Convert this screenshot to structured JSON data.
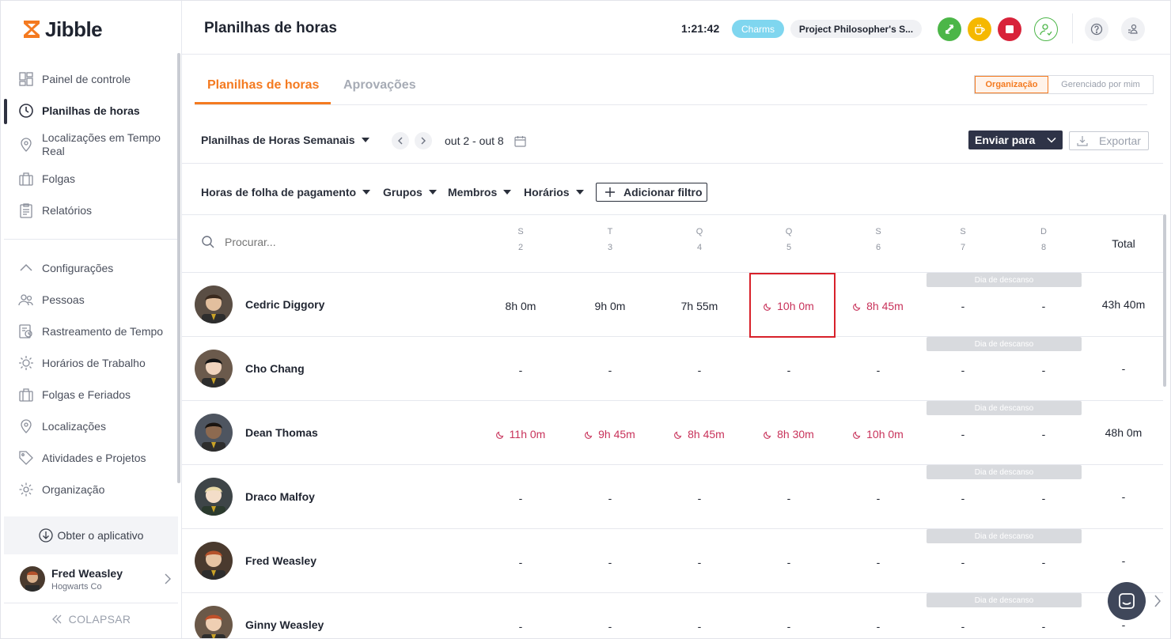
{
  "sidebar": {
    "logo": "Jibble",
    "nav": [
      {
        "label": "Painel de controle",
        "icon": "dashboard-icon"
      },
      {
        "label": "Planilhas de horas",
        "icon": "clock-icon",
        "active": true
      },
      {
        "label": "Localizações em Tempo Real",
        "icon": "location-pin-icon"
      },
      {
        "label": "Folgas",
        "icon": "suitcase-icon"
      },
      {
        "label": "Relatórios",
        "icon": "clipboard-icon"
      }
    ],
    "settings_label": "Configurações",
    "settings": [
      {
        "label": "Pessoas",
        "icon": "people-icon"
      },
      {
        "label": "Rastreamento de Tempo",
        "icon": "time-tracking-icon"
      },
      {
        "label": "Horários de Trabalho",
        "icon": "sun-schedule-icon"
      },
      {
        "label": "Folgas e Feriados",
        "icon": "suitcase-icon"
      },
      {
        "label": "Localizações",
        "icon": "location-pin-icon"
      },
      {
        "label": "Atividades e Projetos",
        "icon": "tag-icon"
      },
      {
        "label": "Organização",
        "icon": "gear-icon"
      }
    ],
    "get_app": "Obter o aplicativo",
    "user": {
      "name": "Fred Weasley",
      "org": "Hogwarts Co"
    },
    "collapse": "COLAPSAR"
  },
  "header": {
    "title": "Planilhas de horas",
    "timer": "1:21:42",
    "activity": "Charms",
    "project": "Project Philosopher's S...",
    "colors": {
      "green": "#4cb648",
      "yellow": "#f5b800",
      "red": "#d8233a",
      "activity": "#7fd6ef"
    }
  },
  "tabs": [
    {
      "label": "Planilhas de horas",
      "active": true
    },
    {
      "label": "Aprovações"
    }
  ],
  "scope_toggle": {
    "options": [
      "Organização",
      "Gerenciado por mim"
    ],
    "selected": "Organização"
  },
  "toolbar": {
    "view": "Planilhas de Horas Semanais",
    "range": "out 2 - out 8",
    "send": "Enviar para",
    "export": "Exportar"
  },
  "filters": {
    "items": [
      "Horas de folha de pagamento",
      "Grupos",
      "Membros",
      "Horários"
    ],
    "add": "Adicionar filtro"
  },
  "table": {
    "search_placeholder": "Procurar...",
    "days": [
      {
        "letter": "S",
        "num": "2"
      },
      {
        "letter": "T",
        "num": "3"
      },
      {
        "letter": "Q",
        "num": "4"
      },
      {
        "letter": "Q",
        "num": "5"
      },
      {
        "letter": "S",
        "num": "6"
      },
      {
        "letter": "S",
        "num": "7"
      },
      {
        "letter": "D",
        "num": "8"
      }
    ],
    "total_label": "Total",
    "rest_label": "Dia de descanso",
    "rows": [
      {
        "name": "Cedric Diggory",
        "cells": [
          "8h 0m",
          "9h 0m",
          "7h 55m",
          "10h 0m",
          "8h 45m",
          "-",
          "-"
        ],
        "overtime": [
          false,
          false,
          false,
          true,
          true,
          false,
          false
        ],
        "total": "43h 40m"
      },
      {
        "name": "Cho Chang",
        "cells": [
          "-",
          "-",
          "-",
          "-",
          "-",
          "-",
          "-"
        ],
        "overtime": [
          false,
          false,
          false,
          false,
          false,
          false,
          false
        ],
        "total": "-"
      },
      {
        "name": "Dean Thomas",
        "cells": [
          "11h 0m",
          "9h 45m",
          "8h 45m",
          "8h 30m",
          "10h 0m",
          "-",
          "-"
        ],
        "overtime": [
          true,
          true,
          true,
          true,
          true,
          false,
          false
        ],
        "total": "48h 0m"
      },
      {
        "name": "Draco Malfoy",
        "cells": [
          "-",
          "-",
          "-",
          "-",
          "-",
          "-",
          "-"
        ],
        "overtime": [
          false,
          false,
          false,
          false,
          false,
          false,
          false
        ],
        "total": "-"
      },
      {
        "name": "Fred Weasley",
        "cells": [
          "-",
          "-",
          "-",
          "-",
          "-",
          "-",
          "-"
        ],
        "overtime": [
          false,
          false,
          false,
          false,
          false,
          false,
          false
        ],
        "total": "-"
      },
      {
        "name": "Ginny Weasley",
        "cells": [
          "-",
          "-",
          "-",
          "-",
          "-",
          "-",
          "-"
        ],
        "overtime": [
          false,
          false,
          false,
          false,
          false,
          false,
          false
        ],
        "total": "-"
      }
    ]
  },
  "colors": {
    "accent": "#f47a20",
    "overtime": "#c8325a",
    "highlight": "#d8212a"
  }
}
